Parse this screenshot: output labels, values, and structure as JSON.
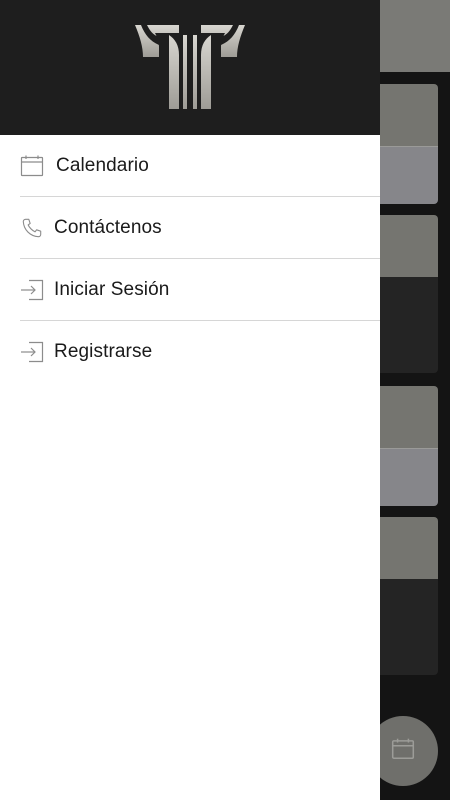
{
  "drawer": {
    "menu": [
      {
        "id": "calendar",
        "label": "Calendario",
        "icon": "calendar-icon"
      },
      {
        "id": "contact",
        "label": "Contáctenos",
        "icon": "phone-icon"
      },
      {
        "id": "login",
        "label": "Iniciar Sesión",
        "icon": "login-icon"
      },
      {
        "id": "register",
        "label": "Registrarse",
        "icon": "login-icon"
      }
    ]
  },
  "colors": {
    "drawer_header": "#1e1e1e",
    "drawer_bg": "#ffffff",
    "divider": "#d6d6d6",
    "icon_gray": "#8c8c8c",
    "scrim_card": "#757570"
  },
  "fab": {
    "icon": "calendar-icon"
  }
}
